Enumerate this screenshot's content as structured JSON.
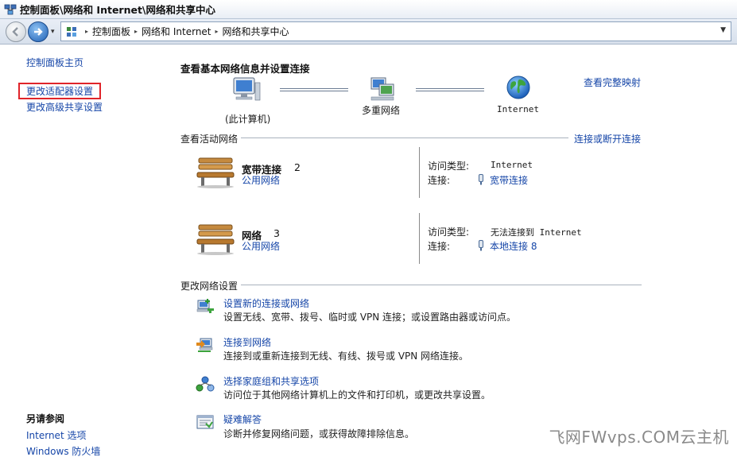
{
  "window": {
    "title": "控制面板\\网络和 Internet\\网络和共享中心"
  },
  "address": {
    "crumbs": [
      "控制面板",
      "网络和 Internet",
      "网络和共享中心"
    ]
  },
  "left_pane": {
    "home": "控制面板主页",
    "change_adapter": "更改适配器设置",
    "change_sharing": "更改高级共享设置",
    "see_also_title": "另请参阅",
    "see_also": [
      "Internet 选项",
      "Windows 防火墙"
    ]
  },
  "main": {
    "heading": "查看基本网络信息并设置连接",
    "view_full_map": "查看完整映射",
    "map": {
      "computer_label": "(此计算机)",
      "network_label": "多重网络",
      "internet_label": "Internet"
    },
    "active_section": "查看活动网络",
    "connect_disconnect": "连接或断开连接",
    "networks": [
      {
        "name": "宽带连接",
        "number": "2",
        "type": "公用网络",
        "access_label": "访问类型:",
        "access_value": "Internet",
        "conn_label": "连接:",
        "conn_value": "宽带连接"
      },
      {
        "name": "网络",
        "number": "3",
        "type": "公用网络",
        "access_label": "访问类型:",
        "access_value": "无法连接到 Internet",
        "conn_label": "连接:",
        "conn_value": "本地连接 8"
      }
    ],
    "change_section": "更改网络设置",
    "tasks": [
      {
        "title": "设置新的连接或网络",
        "desc": "设置无线、宽带、拨号、临时或 VPN 连接；或设置路由器或访问点。",
        "icon": "new-connection-icon"
      },
      {
        "title": "连接到网络",
        "desc": "连接到或重新连接到无线、有线、拨号或 VPN 网络连接。",
        "icon": "connect-network-icon"
      },
      {
        "title": "选择家庭组和共享选项",
        "desc": "访问位于其他网络计算机上的文件和打印机，或更改共享设置。",
        "icon": "homegroup-icon"
      },
      {
        "title": "疑难解答",
        "desc": "诊断并修复网络问题，或获得故障排除信息。",
        "icon": "troubleshoot-icon"
      }
    ]
  },
  "watermark": "飞网FWvps.COM云主机",
  "colors": {
    "link": "#1646a8",
    "highlight_border": "#e0242a"
  }
}
